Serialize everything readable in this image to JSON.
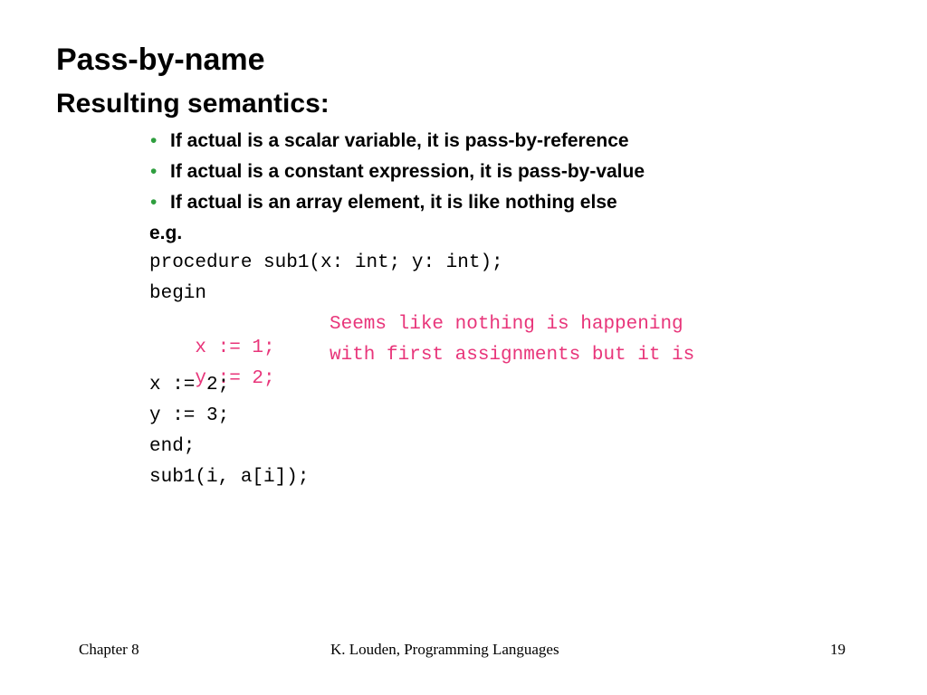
{
  "title": "Pass-by-name",
  "subtitle": "Resulting semantics:",
  "bullet_symbol": "•",
  "bullets": [
    "If actual is a scalar variable, it is pass-by-reference",
    "If actual is a constant expression, it is pass-by-value",
    "If actual is an array element, it is like nothing else"
  ],
  "example_label": "e.g.",
  "code": {
    "line1": "procedure sub1(x: int; y: int);",
    "line2": "begin",
    "line3": "x := 1;",
    "line3_comment": "Seems like nothing is happening",
    "line4": "y := 2;",
    "line4_comment": "with first assignments but it is",
    "line5": "x := 2;",
    "line6": "y := 3;",
    "line7": "end;",
    "line8": "sub1(i, a[i]);"
  },
  "footer": {
    "chapter": "Chapter 8",
    "course": "K. Louden, Programming Languages",
    "page_number": "19"
  },
  "colors": {
    "bullet": "#2e9e3e",
    "highlight": "#e8357a",
    "text": "#000000",
    "background": "#ffffff"
  }
}
